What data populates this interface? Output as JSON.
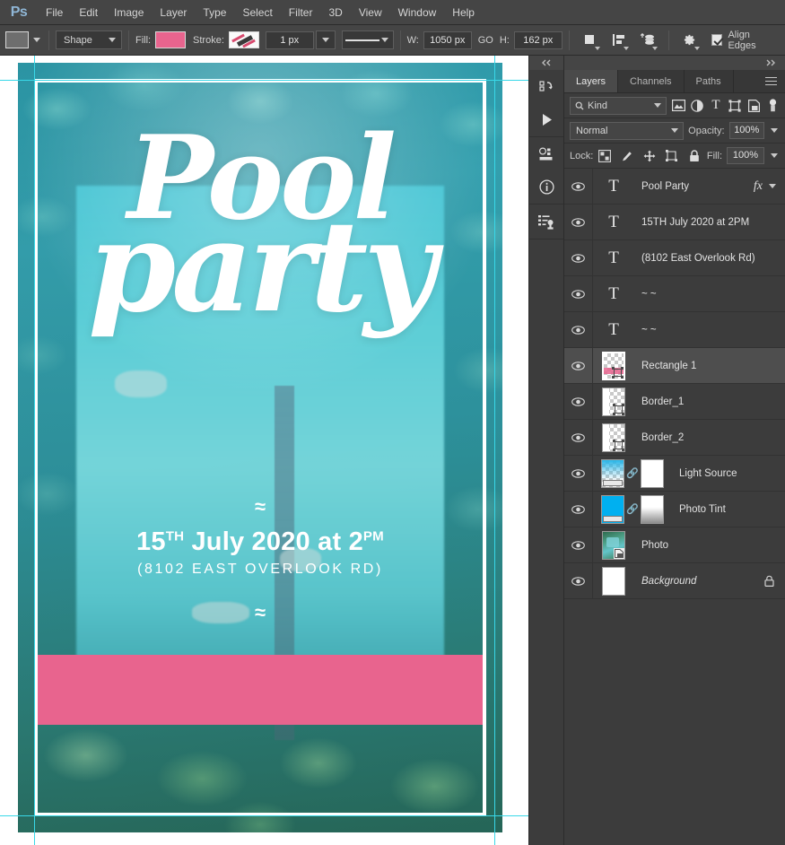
{
  "app": {
    "logo": "Ps"
  },
  "menubar": {
    "items": [
      "File",
      "Edit",
      "Image",
      "Layer",
      "Type",
      "Select",
      "Filter",
      "3D",
      "View",
      "Window",
      "Help"
    ]
  },
  "options_bar": {
    "tool_preset_name": "rectangle-tool-preset",
    "mode_value": "Shape",
    "fill_label": "Fill:",
    "fill_color": "#E8648E",
    "stroke_label": "Stroke:",
    "stroke_width_value": "1 px",
    "stroke_style_name": "solid-line",
    "width_label": "W:",
    "width_value": "1050 px",
    "link_label": "GO",
    "height_label": "H:",
    "height_value": "162 px",
    "path_operations_icon": "path-operations-icon",
    "path_alignment_icon": "path-alignment-icon",
    "path_arrangement_icon": "path-arrangement-icon",
    "settings_icon": "gear-icon",
    "align_edges_label": "Align Edges",
    "align_edges_checked": true
  },
  "icon_dock": {
    "collapse_icon": "double-chevron-left-icon",
    "items": [
      {
        "name": "history-icon"
      },
      {
        "name": "play-actions-icon"
      },
      {
        "name": "properties-icon"
      },
      {
        "name": "info-icon"
      },
      {
        "name": "clone-source-icon"
      }
    ]
  },
  "layers_panel": {
    "collapse_icon": "double-chevron-right-icon",
    "tabs": [
      {
        "label": "Layers",
        "active": true
      },
      {
        "label": "Channels",
        "active": false
      },
      {
        "label": "Paths",
        "active": false
      }
    ],
    "menu_icon": "panel-menu-icon",
    "filter": {
      "search_icon": "search-icon",
      "kind_value": "Kind",
      "icons": [
        "filter-pixel-icon",
        "filter-adjustment-icon",
        "filter-type-icon",
        "filter-shape-icon",
        "filter-smart-object-icon",
        "filter-toggle-icon"
      ]
    },
    "blend_mode": "Normal",
    "opacity_label": "Opacity:",
    "opacity_value": "100%",
    "lock_label": "Lock:",
    "lock_icons": [
      "lock-transparent-pixels-icon",
      "lock-image-pixels-icon",
      "lock-position-icon",
      "lock-artboard-nesting-icon",
      "lock-all-icon"
    ],
    "fill_label": "Fill:",
    "fill_value": "100%",
    "layers": [
      {
        "name": "Pool  Party",
        "type": "text",
        "visible": true,
        "selected": false,
        "has_fx": true,
        "fx_label": "fx"
      },
      {
        "name": "15TH July 2020 at 2PM",
        "type": "text",
        "visible": true,
        "selected": false,
        "has_fx": false
      },
      {
        "name": "(8102 East Overlook Rd)",
        "type": "text",
        "visible": true,
        "selected": false,
        "has_fx": false
      },
      {
        "name": "~ ~",
        "type": "text",
        "visible": true,
        "selected": false,
        "has_fx": false
      },
      {
        "name": "~ ~",
        "type": "text",
        "visible": true,
        "selected": false,
        "has_fx": false
      },
      {
        "name": "Rectangle 1",
        "type": "shape",
        "visible": true,
        "selected": true,
        "has_fx": false
      },
      {
        "name": "Border_1",
        "type": "shape",
        "visible": true,
        "selected": false,
        "has_fx": false
      },
      {
        "name": "Border_2",
        "type": "shape",
        "visible": true,
        "selected": false,
        "has_fx": false
      },
      {
        "name": "Light Source",
        "type": "masked-gradient",
        "visible": true,
        "selected": false,
        "has_fx": false
      },
      {
        "name": "Photo Tint",
        "type": "masked-solid",
        "visible": true,
        "selected": false,
        "has_fx": false
      },
      {
        "name": "Photo",
        "type": "smart-object",
        "visible": true,
        "selected": false,
        "has_fx": false
      },
      {
        "name": "Background",
        "type": "background",
        "visible": true,
        "selected": false,
        "has_fx": false,
        "locked": true,
        "italic": true
      }
    ]
  },
  "canvas": {
    "guide_color": "#39d8e8",
    "flyer": {
      "title_line1": "Pool",
      "title_line2": "party",
      "wave_top": "≈",
      "date_main": "15",
      "date_sup1": "TH",
      "date_mid": " July 2020 at 2",
      "date_sup2": "PM",
      "address": "(8102 EAST OVERLOOK RD)",
      "wave_bottom": "≈",
      "bar_color": "#E8648E"
    }
  }
}
